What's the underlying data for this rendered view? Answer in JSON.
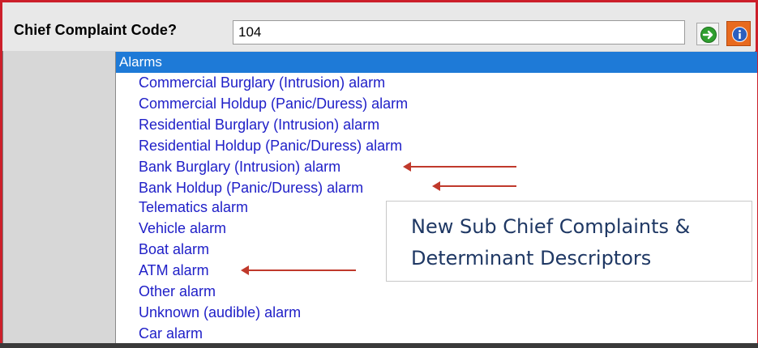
{
  "field": {
    "label": "Chief Complaint Code?",
    "value": "104"
  },
  "buttons": {
    "go_icon": "green-arrow-icon",
    "info_icon": "info-icon"
  },
  "list": {
    "header": "Alarms",
    "items": [
      "Commercial Burglary (Intrusion) alarm",
      "Commercial Holdup (Panic/Duress) alarm",
      "Residential Burglary (Intrusion) alarm",
      "Residential Holdup (Panic/Duress) alarm",
      "Bank Burglary (Intrusion) alarm",
      "Bank Holdup (Panic/Duress) alarm",
      "Telematics alarm",
      "Vehicle alarm",
      "Boat alarm",
      "ATM alarm",
      "Other alarm",
      "Unknown (audible) alarm",
      "Car alarm"
    ]
  },
  "callout": {
    "line1": "New Sub Chief Complaints &",
    "line2": "Determinant Descriptors"
  },
  "colors": {
    "frame": "#cc1f2a",
    "list_header": "#1e7ad7",
    "item_text": "#2020c8",
    "arrow": "#c0392b",
    "callout_text": "#1f3864"
  }
}
